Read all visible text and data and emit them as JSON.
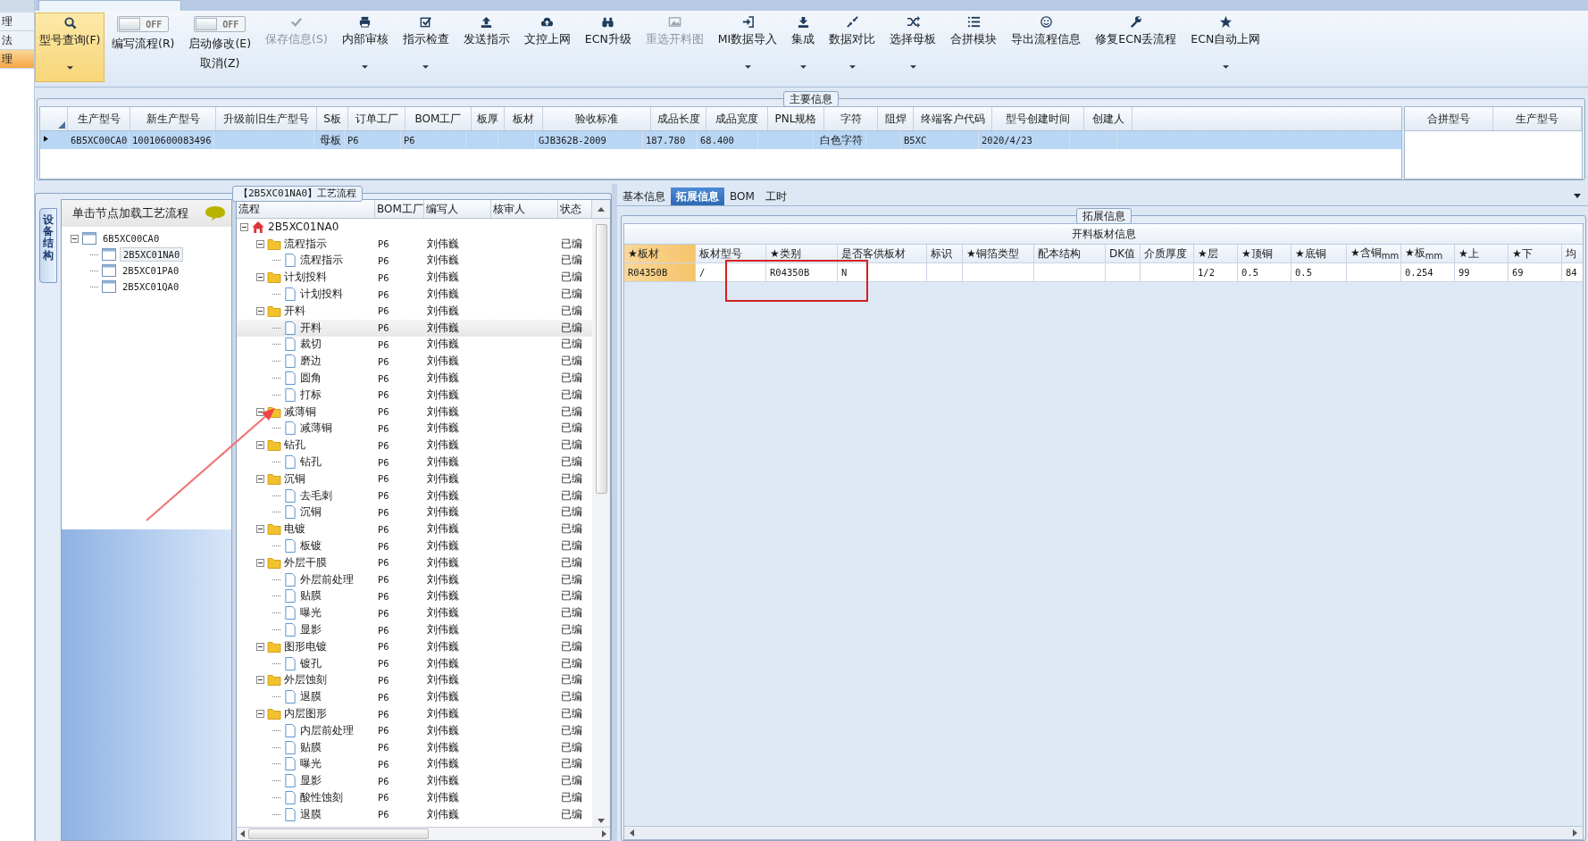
{
  "left_nav": [
    {
      "label": "理",
      "selected": false
    },
    {
      "label": "法",
      "selected": false
    },
    {
      "label": "理",
      "selected": true
    }
  ],
  "ribbon": {
    "buttons": [
      {
        "kind": "large",
        "label": "型号查询(F)",
        "selected": true,
        "disabled": false,
        "dropdown": true
      },
      {
        "kind": "toggle",
        "label": "编写流程(R)",
        "switch_text": "OFF",
        "on": false
      },
      {
        "kind": "toggle",
        "label": "启动修改(E)",
        "label2": "取消(Z)",
        "switch_text": "OFF",
        "on": false
      },
      {
        "kind": "large",
        "label": "保存信息(S)",
        "selected": false,
        "disabled": true,
        "dropdown": false
      },
      {
        "kind": "large",
        "label": "内部审核",
        "selected": false,
        "disabled": false,
        "dropdown": true
      },
      {
        "kind": "large",
        "label": "指示检查",
        "selected": false,
        "disabled": false,
        "dropdown": true
      },
      {
        "kind": "large",
        "label": "发送指示",
        "selected": false,
        "disabled": false,
        "dropdown": false
      },
      {
        "kind": "large",
        "label": "文控上网",
        "selected": false,
        "disabled": false,
        "dropdown": false
      },
      {
        "kind": "large",
        "label": "ECN升级",
        "selected": false,
        "disabled": false,
        "dropdown": false
      },
      {
        "kind": "large",
        "label": "重选开料图",
        "selected": false,
        "disabled": true,
        "dropdown": false
      },
      {
        "kind": "large",
        "label": "MI数据导入",
        "selected": false,
        "disabled": false,
        "dropdown": true
      },
      {
        "kind": "large",
        "label": "集成",
        "selected": false,
        "disabled": false,
        "dropdown": true
      },
      {
        "kind": "large",
        "label": "数据对比",
        "selected": false,
        "disabled": false,
        "dropdown": true
      },
      {
        "kind": "large",
        "label": "选择母板",
        "selected": false,
        "disabled": false,
        "dropdown": true
      },
      {
        "kind": "large",
        "label": "合拼模块",
        "selected": false,
        "disabled": false,
        "dropdown": false
      },
      {
        "kind": "large",
        "label": "导出流程信息",
        "selected": false,
        "disabled": false,
        "dropdown": false
      },
      {
        "kind": "large",
        "label": "修复ECN丢流程",
        "selected": false,
        "disabled": false,
        "dropdown": false
      },
      {
        "kind": "large",
        "label": "ECN自动上网",
        "selected": false,
        "disabled": false,
        "dropdown": true
      }
    ]
  },
  "main_info": {
    "title": "主要信息",
    "columns": [
      "生产型号",
      "新生产型号",
      "升级前旧生产型号",
      "S板",
      "订单工厂",
      "BOM工厂",
      "板厚",
      "板材",
      "验收标准",
      "成品长度",
      "成品宽度",
      "PNL规格",
      "字符",
      "阻焊",
      "终端客户代码",
      "型号创建时间",
      "创建人"
    ],
    "rows": [
      {
        "selected": true,
        "cells": [
          "6B5XC00CA0",
          "10010600083496",
          "",
          "母板",
          "P6",
          "P6",
          "",
          "",
          "GJB362B-2009",
          "187.780",
          "68.400",
          "",
          "白色字符",
          "",
          "B5XC",
          "2020/4/23",
          ""
        ]
      }
    ],
    "merge_table": {
      "columns": [
        "合拼型号",
        "生产型号"
      ]
    }
  },
  "flow_panel": {
    "title": "【2B5XC01NA0】工艺流程",
    "side_tab": "设备结构",
    "device_tree": {
      "header": "单击节点加载工艺流程",
      "nodes": [
        {
          "label": "6B5XC00CA0",
          "expanded": true,
          "selected": false,
          "children": [
            {
              "label": "2B5XC01NA0",
              "selected": true
            },
            {
              "label": "2B5XC01PA0",
              "selected": false
            },
            {
              "label": "2B5XC01QA0",
              "selected": false
            }
          ]
        }
      ]
    },
    "flow_tree": {
      "columns": [
        "流程",
        "BOM工厂",
        "编写人",
        "核审人",
        "状态"
      ],
      "nodes": [
        {
          "label": "2B5XC01NA0",
          "kind": "root",
          "expanded": true,
          "selected": false,
          "children": [
            {
              "label": "流程指示",
              "kind": "folder",
              "bom_factory": "P6",
              "writer": "刘伟巍",
              "status": "已编",
              "expanded": true,
              "selected": false,
              "children": [
                {
                  "label": "流程指示",
                  "kind": "step",
                  "bom_factory": "P6",
                  "writer": "刘伟巍",
                  "status": "已编",
                  "selected": false
                }
              ]
            },
            {
              "label": "计划投料",
              "kind": "folder",
              "bom_factory": "P6",
              "writer": "刘伟巍",
              "status": "已编",
              "expanded": true,
              "selected": false,
              "children": [
                {
                  "label": "计划投料",
                  "kind": "step",
                  "bom_factory": "P6",
                  "writer": "刘伟巍",
                  "status": "已编",
                  "selected": false
                }
              ]
            },
            {
              "label": "开料",
              "kind": "folder",
              "bom_factory": "P6",
              "writer": "刘伟巍",
              "status": "已编",
              "expanded": true,
              "selected": false,
              "children": [
                {
                  "label": "开料",
                  "kind": "step",
                  "bom_factory": "P6",
                  "writer": "刘伟巍",
                  "status": "已编",
                  "selected": true
                },
                {
                  "label": "裁切",
                  "kind": "step",
                  "bom_factory": "P6",
                  "writer": "刘伟巍",
                  "status": "已编",
                  "selected": false
                },
                {
                  "label": "磨边",
                  "kind": "step",
                  "bom_factory": "P6",
                  "writer": "刘伟巍",
                  "status": "已编",
                  "selected": false
                },
                {
                  "label": "圆角",
                  "kind": "step",
                  "bom_factory": "P6",
                  "writer": "刘伟巍",
                  "status": "已编",
                  "selected": false
                },
                {
                  "label": "打标",
                  "kind": "step",
                  "bom_factory": "P6",
                  "writer": "刘伟巍",
                  "status": "已编",
                  "selected": false
                }
              ]
            },
            {
              "label": "减薄铜",
              "kind": "folder",
              "bom_factory": "P6",
              "writer": "刘伟巍",
              "status": "已编",
              "expanded": true,
              "selected": false,
              "children": [
                {
                  "label": "减薄铜",
                  "kind": "step",
                  "bom_factory": "P6",
                  "writer": "刘伟巍",
                  "status": "已编",
                  "selected": false
                }
              ]
            },
            {
              "label": "钻孔",
              "kind": "folder",
              "bom_factory": "P6",
              "writer": "刘伟巍",
              "status": "已编",
              "expanded": true,
              "selected": false,
              "children": [
                {
                  "label": "钻孔",
                  "kind": "step",
                  "bom_factory": "P6",
                  "writer": "刘伟巍",
                  "status": "已编",
                  "selected": false
                }
              ]
            },
            {
              "label": "沉铜",
              "kind": "folder",
              "bom_factory": "P6",
              "writer": "刘伟巍",
              "status": "已编",
              "expanded": true,
              "selected": false,
              "children": [
                {
                  "label": "去毛刺",
                  "kind": "step",
                  "bom_factory": "P6",
                  "writer": "刘伟巍",
                  "status": "已编",
                  "selected": false
                },
                {
                  "label": "沉铜",
                  "kind": "step",
                  "bom_factory": "P6",
                  "writer": "刘伟巍",
                  "status": "已编",
                  "selected": false
                }
              ]
            },
            {
              "label": "电镀",
              "kind": "folder",
              "bom_factory": "P6",
              "writer": "刘伟巍",
              "status": "已编",
              "expanded": true,
              "selected": false,
              "children": [
                {
                  "label": "板镀",
                  "kind": "step",
                  "bom_factory": "P6",
                  "writer": "刘伟巍",
                  "status": "已编",
                  "selected": false
                }
              ]
            },
            {
              "label": "外层干膜",
              "kind": "folder",
              "bom_factory": "P6",
              "writer": "刘伟巍",
              "status": "已编",
              "expanded": true,
              "selected": false,
              "children": [
                {
                  "label": "外层前处理",
                  "kind": "step",
                  "bom_factory": "P6",
                  "writer": "刘伟巍",
                  "status": "已编",
                  "selected": false
                },
                {
                  "label": "贴膜",
                  "kind": "step",
                  "bom_factory": "P6",
                  "writer": "刘伟巍",
                  "status": "已编",
                  "selected": false
                },
                {
                  "label": "曝光",
                  "kind": "step",
                  "bom_factory": "P6",
                  "writer": "刘伟巍",
                  "status": "已编",
                  "selected": false
                },
                {
                  "label": "显影",
                  "kind": "step",
                  "bom_factory": "P6",
                  "writer": "刘伟巍",
                  "status": "已编",
                  "selected": false
                }
              ]
            },
            {
              "label": "图形电镀",
              "kind": "folder",
              "bom_factory": "P6",
              "writer": "刘伟巍",
              "status": "已编",
              "expanded": true,
              "selected": false,
              "children": [
                {
                  "label": "镀孔",
                  "kind": "step",
                  "bom_factory": "P6",
                  "writer": "刘伟巍",
                  "status": "已编",
                  "selected": false
                }
              ]
            },
            {
              "label": "外层蚀刻",
              "kind": "folder",
              "bom_factory": "P6",
              "writer": "刘伟巍",
              "status": "已编",
              "expanded": true,
              "selected": false,
              "children": [
                {
                  "label": "退膜",
                  "kind": "step",
                  "bom_factory": "P6",
                  "writer": "刘伟巍",
                  "status": "已编",
                  "selected": false
                }
              ]
            },
            {
              "label": "内层图形",
              "kind": "folder",
              "bom_factory": "P6",
              "writer": "刘伟巍",
              "status": "已编",
              "expanded": true,
              "selected": false,
              "children": [
                {
                  "label": "内层前处理",
                  "kind": "step",
                  "bom_factory": "P6",
                  "writer": "刘伟巍",
                  "status": "已编",
                  "selected": false
                },
                {
                  "label": "贴膜",
                  "kind": "step",
                  "bom_factory": "P6",
                  "writer": "刘伟巍",
                  "status": "已编",
                  "selected": false
                },
                {
                  "label": "曝光",
                  "kind": "step",
                  "bom_factory": "P6",
                  "writer": "刘伟巍",
                  "status": "已编",
                  "selected": false
                },
                {
                  "label": "显影",
                  "kind": "step",
                  "bom_factory": "P6",
                  "writer": "刘伟巍",
                  "status": "已编",
                  "selected": false
                },
                {
                  "label": "酸性蚀刻",
                  "kind": "step",
                  "bom_factory": "P6",
                  "writer": "刘伟巍",
                  "status": "已编",
                  "selected": false
                },
                {
                  "label": "退膜",
                  "kind": "step",
                  "bom_factory": "P6",
                  "writer": "刘伟巍",
                  "status": "已编",
                  "selected": false
                }
              ]
            }
          ]
        }
      ]
    }
  },
  "detail_panel": {
    "tabs": [
      {
        "label": "基本信息",
        "selected": false
      },
      {
        "label": "拓展信息",
        "selected": true
      },
      {
        "label": "BOM",
        "selected": false
      },
      {
        "label": "工时",
        "selected": false
      }
    ],
    "group_title": "拓展信息",
    "table": {
      "caption": "开料板材信息",
      "columns": [
        {
          "label": "★板材",
          "selected": true
        },
        {
          "label": "板材型号",
          "selected": false
        },
        {
          "label": "★类别",
          "selected": false
        },
        {
          "label": "是否客供板材",
          "selected": false
        },
        {
          "label": "标识",
          "selected": false
        },
        {
          "label": "★铜箔类型",
          "selected": false
        },
        {
          "label": "配本结构",
          "selected": false
        },
        {
          "label": "DK值",
          "selected": false
        },
        {
          "label": "介质厚度",
          "selected": false
        },
        {
          "label": "★层",
          "selected": false
        },
        {
          "label": "★顶铜",
          "selected": false
        },
        {
          "label": "★底铜",
          "selected": false
        },
        {
          "label": "★含铜$_{mm}$",
          "selected": false
        },
        {
          "label": "★板$_{mm}$",
          "selected": false
        },
        {
          "label": "★上",
          "selected": false
        },
        {
          "label": "★下",
          "selected": false
        },
        {
          "label": "均",
          "selected": false
        }
      ],
      "rows": [
        [
          "R04350B",
          "/",
          "R04350B",
          "N",
          "",
          "",
          "",
          "",
          "",
          "1/2",
          "0.5",
          "0.5",
          "",
          "0.254",
          "99",
          "69",
          "84"
        ]
      ]
    }
  }
}
